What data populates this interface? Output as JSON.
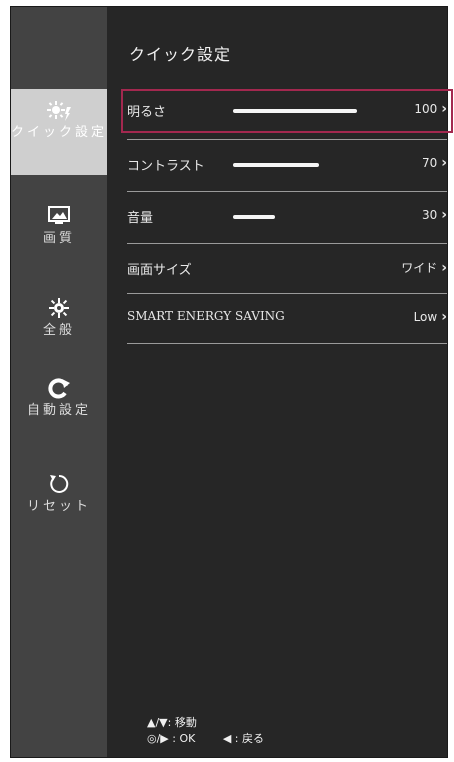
{
  "title": "クイック設定",
  "sidebar": {
    "items": [
      {
        "label": "クイック設定",
        "icon": "brightness-gear-icon",
        "active": true
      },
      {
        "label": "画質",
        "icon": "picture-monitor-icon",
        "active": false
      },
      {
        "label": "全般",
        "icon": "gear-icon",
        "active": false
      },
      {
        "label": "自動設定",
        "icon": "auto-setting-icon",
        "active": false
      },
      {
        "label": "リセット",
        "icon": "reset-icon",
        "active": false
      }
    ]
  },
  "settings": [
    {
      "label": "明るさ",
      "value": "100",
      "level": 1.0
    },
    {
      "label": "コントラスト",
      "value": "70",
      "level": 0.7
    },
    {
      "label": "音量",
      "value": "30",
      "level": 0.3
    },
    {
      "label": "画面サイズ",
      "value": "ワイド"
    },
    {
      "label": "SMART ENERGY SAVING",
      "value": "Low"
    }
  ],
  "chevron": "›",
  "footer": {
    "move": "▲/▼: 移動",
    "ok": "◎/▶ : OK",
    "back": "◀ : 戻る"
  },
  "colors": {
    "highlight": "#a3284f",
    "sidebar_bg": "#434343",
    "active_bg": "#cfcfcf",
    "panel_bg": "#262626"
  }
}
